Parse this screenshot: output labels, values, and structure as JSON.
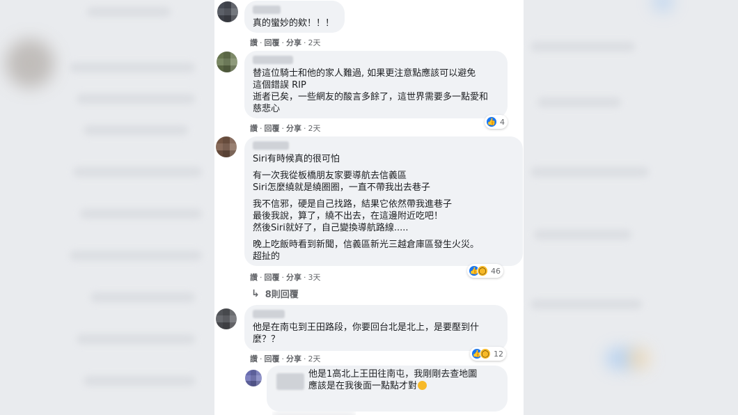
{
  "comments": [
    {
      "text": "真的蠻妙的欸！！！",
      "actions": {
        "like": "讚",
        "reply": "回覆",
        "share": "分享",
        "time": "2天"
      }
    },
    {
      "text": "替這位騎士和他的家人難過, 如果更注意點應該可以避免\n這個錯誤 RIP\n逝者已矣，一些網友的酸言多餘了，這世界需要多一點愛和\n慈悲心",
      "actions": {
        "like": "讚",
        "reply": "回覆",
        "share": "分享",
        "time": "2天"
      },
      "reaction_count": "4"
    },
    {
      "paragraphs": [
        "Siri有時候真的很可怕",
        "有一次我從板橋朋友家要導航去信義區\nSiri怎麼繞就是繞圈圈，一直不帶我出去巷子",
        "我不信邪，硬是自己找路，結果它依然帶我進巷子\n最後我說，算了，繞不出去，在這邊附近吃吧！\n然後Siri就好了，自己變換導航路線.....",
        "晚上吃飯時看到新聞，信義區新光三越倉庫區發生火災。\n超扯的"
      ],
      "actions": {
        "like": "讚",
        "reply": "回覆",
        "share": "分享",
        "time": "3天"
      },
      "reaction_count": "46",
      "replies_label": "8則回覆"
    },
    {
      "text": "他是在南屯到王田路段，你要回台北是北上，是要壓到什\n麼？？",
      "actions": {
        "like": "讚",
        "reply": "回覆",
        "share": "分享",
        "time": "2天"
      },
      "reaction_count": "12"
    },
    {
      "text": "他是1高北上王田往南屯，我剛剛去查地圖\n應該是在我後面一點點才對"
    }
  ],
  "icons": {
    "like": "like-icon",
    "wow": "wow-icon",
    "reply_arrow": "reply-arrow-icon",
    "grin_emoji": "grinning-face-emoji"
  },
  "colors": {
    "like_blue": "#1877f2",
    "wow_yellow": "#f7b928",
    "bubble_gray": "#f0f2f5"
  }
}
